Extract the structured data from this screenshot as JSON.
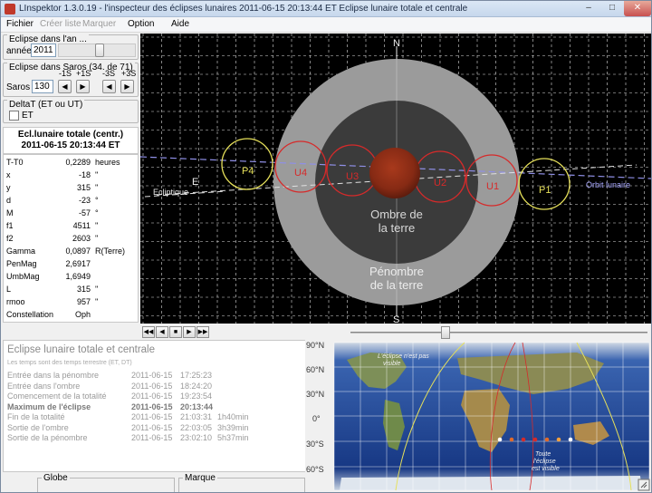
{
  "window": {
    "title": "LInspektor 1.3.0.19 - l'inspecteur des éclipses lunaires      2011-06-15  20:13:44 ET     Eclipse lunaire totale et centrale",
    "controls": {
      "minimize": "–",
      "maximize": "□",
      "close": "✕"
    }
  },
  "menu": [
    {
      "label": "Fichier",
      "enabled": true
    },
    {
      "label": "Créer liste",
      "enabled": false
    },
    {
      "label": "Marquer",
      "enabled": false
    },
    {
      "label": "Option",
      "enabled": true
    },
    {
      "label": "Aide",
      "enabled": true
    }
  ],
  "left": {
    "year_group": {
      "legend": "Eclipse dans l'an ...",
      "label": "année",
      "value": "2011"
    },
    "saros_group": {
      "legend": "Eclipse dans Saros (34. de 71)",
      "steps": [
        "-1S",
        "+1S",
        "-3S",
        "+3S"
      ],
      "label": "Saros",
      "value": "130"
    },
    "deltat_group": {
      "legend": "DeltaT (ET ou UT)",
      "checkbox_label": "ET"
    },
    "eclipse_header": {
      "type": "Ecl.lunaire totale (centr.)",
      "datetime": "2011-06-15   20:13:44 ET"
    },
    "rows": [
      {
        "k": "T-T0",
        "v": "0,2289",
        "u": "heures"
      },
      {
        "k": "x",
        "v": "-18",
        "u": "''"
      },
      {
        "k": "y",
        "v": "315",
        "u": "''"
      },
      {
        "k": "d",
        "v": "-23",
        "u": "°"
      },
      {
        "k": "M",
        "v": "-57",
        "u": "°"
      },
      {
        "k": "f1",
        "v": "4511",
        "u": "''"
      },
      {
        "k": "f2",
        "v": "2603",
        "u": "''"
      },
      {
        "k": "Gamma",
        "v": "0,0897",
        "u": "R(Terre)"
      },
      {
        "k": "PenMag",
        "v": "2,6917",
        "u": ""
      },
      {
        "k": "UmbMag",
        "v": "1,6949",
        "u": ""
      },
      {
        "k": "L",
        "v": "315",
        "u": "''"
      },
      {
        "k": "rmoo",
        "v": "957",
        "u": "''"
      },
      {
        "k": "Constellation",
        "v": "Oph",
        "u": ""
      }
    ]
  },
  "sky": {
    "north": "N",
    "south": "S",
    "east": "E",
    "umbra_label_1": "Ombre de",
    "umbra_label_2": "la terre",
    "penumbra_label_1": "Pénombre",
    "penumbra_label_2": "de la terre",
    "ecliptic_label": "Ecliptique",
    "orbit_label": "Orbit lunaire",
    "contacts": [
      "P4",
      "U4",
      "U3",
      "U2",
      "U1",
      "P1"
    ],
    "colors": {
      "background": "#000000",
      "penumbra": "#9a9a9a",
      "umbra": "#3c3c3c",
      "moon": "#8e2e17",
      "penumbral_contact": "#e6e05a",
      "umbral_contact": "#d62a2a",
      "orbit": "#8f8fe6"
    }
  },
  "animation": {
    "buttons": [
      "◀◀",
      "◀",
      "■",
      "▶",
      "▶▶"
    ]
  },
  "info": {
    "title": "Eclipse lunaire totale et centrale",
    "subtitle": "Les temps sont des temps terrestre (ET, DT)",
    "rows": [
      {
        "k": "Entrée dans la pénombre",
        "d": "2011-06-15",
        "t": "17:25:23",
        "dur": "",
        "bold": false
      },
      {
        "k": "Entrée dans l'ombre",
        "d": "2011-06-15",
        "t": "18:24:20",
        "dur": "",
        "bold": false
      },
      {
        "k": "Comencement de la totalité",
        "d": "2011-06-15",
        "t": "19:23:54",
        "dur": "",
        "bold": false
      },
      {
        "k": "Maximum de l'éclipse",
        "d": "2011-06-15",
        "t": "20:13:44",
        "dur": "",
        "bold": true
      },
      {
        "k": "Fin de la totalité",
        "d": "2011-06-15",
        "t": "21:03:31",
        "dur": "1h40min",
        "bold": false
      },
      {
        "k": "Sortie de l'ombre",
        "d": "2011-06-15",
        "t": "22:03:05",
        "dur": "3h39min",
        "bold": false
      },
      {
        "k": "Sortie de la pénombre",
        "d": "2011-06-15",
        "t": "23:02:10",
        "dur": "5h37min",
        "bold": false
      }
    ]
  },
  "map": {
    "lat_labels": [
      "90°N",
      "60°N",
      "30°N",
      "0°",
      "30°S",
      "60°S"
    ],
    "text_visible": [
      "L'éclipse n'est pas",
      "visible"
    ],
    "text_total": [
      "Toute",
      "l'éclipse",
      "est visible"
    ]
  },
  "bottom": {
    "globe_legend": "Globe",
    "marque_legend": "Marque"
  }
}
